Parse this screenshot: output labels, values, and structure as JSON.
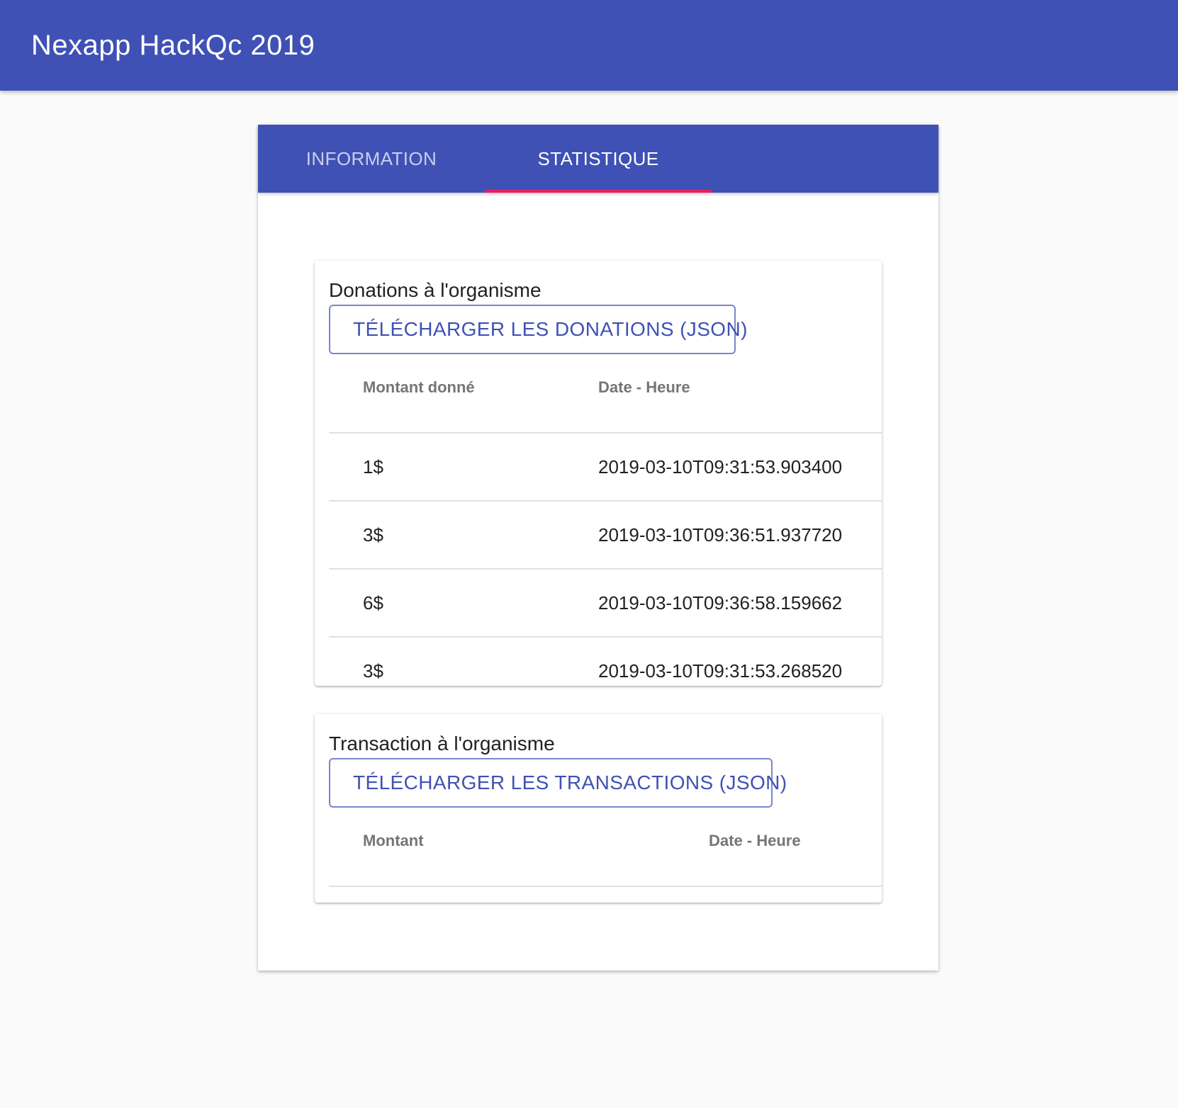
{
  "app": {
    "title": "Nexapp HackQc 2019"
  },
  "tabs": [
    {
      "label": "INFORMATION",
      "active": false
    },
    {
      "label": "STATISTIQUE",
      "active": true
    }
  ],
  "donations": {
    "title": "Donations à l'organisme",
    "download_label": "TÉLÉCHARGER LES DONATIONS (JSON)",
    "columns": [
      "Montant donné",
      "Date - Heure"
    ],
    "rows": [
      {
        "amount": "1$",
        "datetime": "2019-03-10T09:31:53.903400"
      },
      {
        "amount": "3$",
        "datetime": "2019-03-10T09:36:51.937720"
      },
      {
        "amount": "6$",
        "datetime": "2019-03-10T09:36:58.159662"
      },
      {
        "amount": "3$",
        "datetime": "2019-03-10T09:31:53.268520"
      }
    ]
  },
  "transactions": {
    "title": "Transaction à l'organisme",
    "download_label": "TÉLÉCHARGER LES TRANSACTIONS (JSON)",
    "columns": [
      "Montant",
      "Date - Heure"
    ],
    "rows": []
  },
  "colors": {
    "primary": "#3f51b5",
    "accent": "#e91e63",
    "background": "#fafafa",
    "button_border": "#7986cb"
  }
}
